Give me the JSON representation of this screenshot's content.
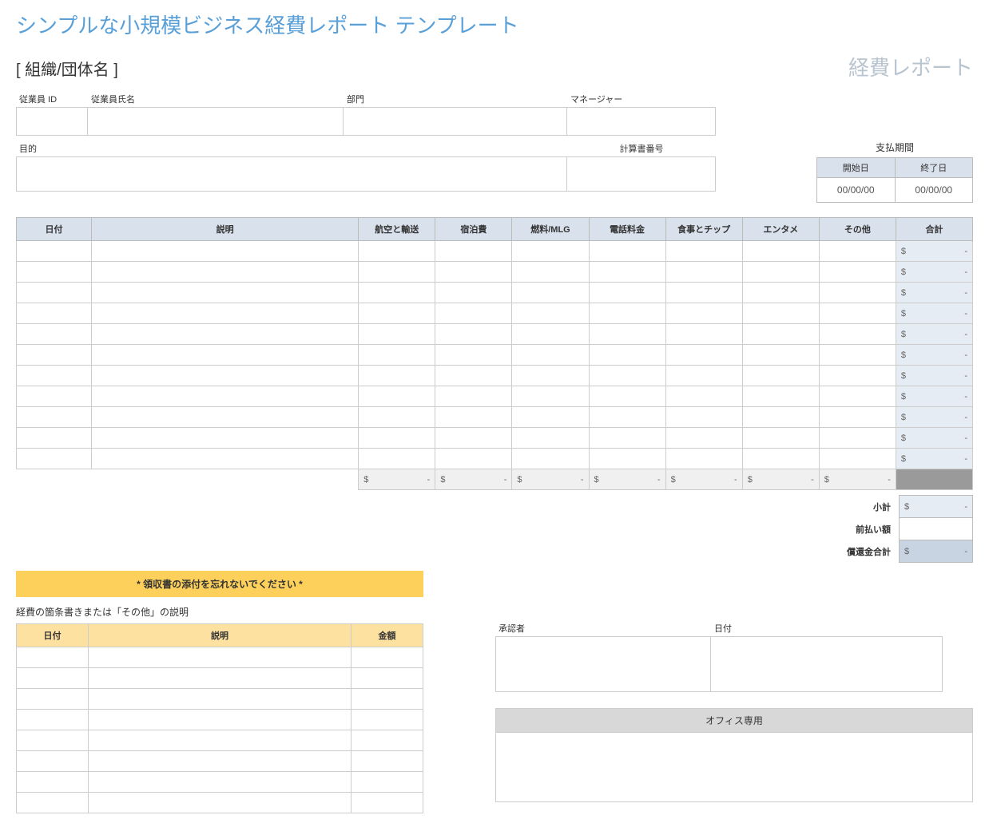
{
  "title": "シンプルな小規模ビジネス経費レポート テンプレート",
  "org_name": "[ 組織/団体名 ]",
  "report_label": "経費レポート",
  "info": {
    "employee_id": "従業員 ID",
    "employee_name": "従業員氏名",
    "department": "部門",
    "manager": "マネージャー",
    "purpose": "目的",
    "statement_number": "計算書番号"
  },
  "pay_period": {
    "title": "支払期間",
    "start_label": "開始日",
    "end_label": "終了日",
    "start_value": "00/00/00",
    "end_value": "00/00/00"
  },
  "expense_table": {
    "headers": {
      "date": "日付",
      "description": "説明",
      "air_transport": "航空と輸送",
      "lodging": "宿泊費",
      "fuel_mlg": "燃料/MLG",
      "phone": "電話料金",
      "meals_tips": "食事とチップ",
      "entertainment": "エンタメ",
      "other": "その他",
      "total": "合計"
    },
    "row_count": 11,
    "currency_symbol": "$",
    "empty_value": "-"
  },
  "totals": {
    "subtotal_label": "小計",
    "advance_label": "前払い額",
    "reimbursement_label": "償還金合計",
    "currency_symbol": "$",
    "empty_value": "-"
  },
  "reminder": "* 領収書の添付を忘れないでください *",
  "itemize": {
    "label": "経費の箇条書きまたは「その他」の説明",
    "headers": {
      "date": "日付",
      "description": "説明",
      "amount": "金額"
    },
    "row_count": 8
  },
  "approval": {
    "approver_label": "承認者",
    "date_label": "日付"
  },
  "office_only": "オフィス専用"
}
